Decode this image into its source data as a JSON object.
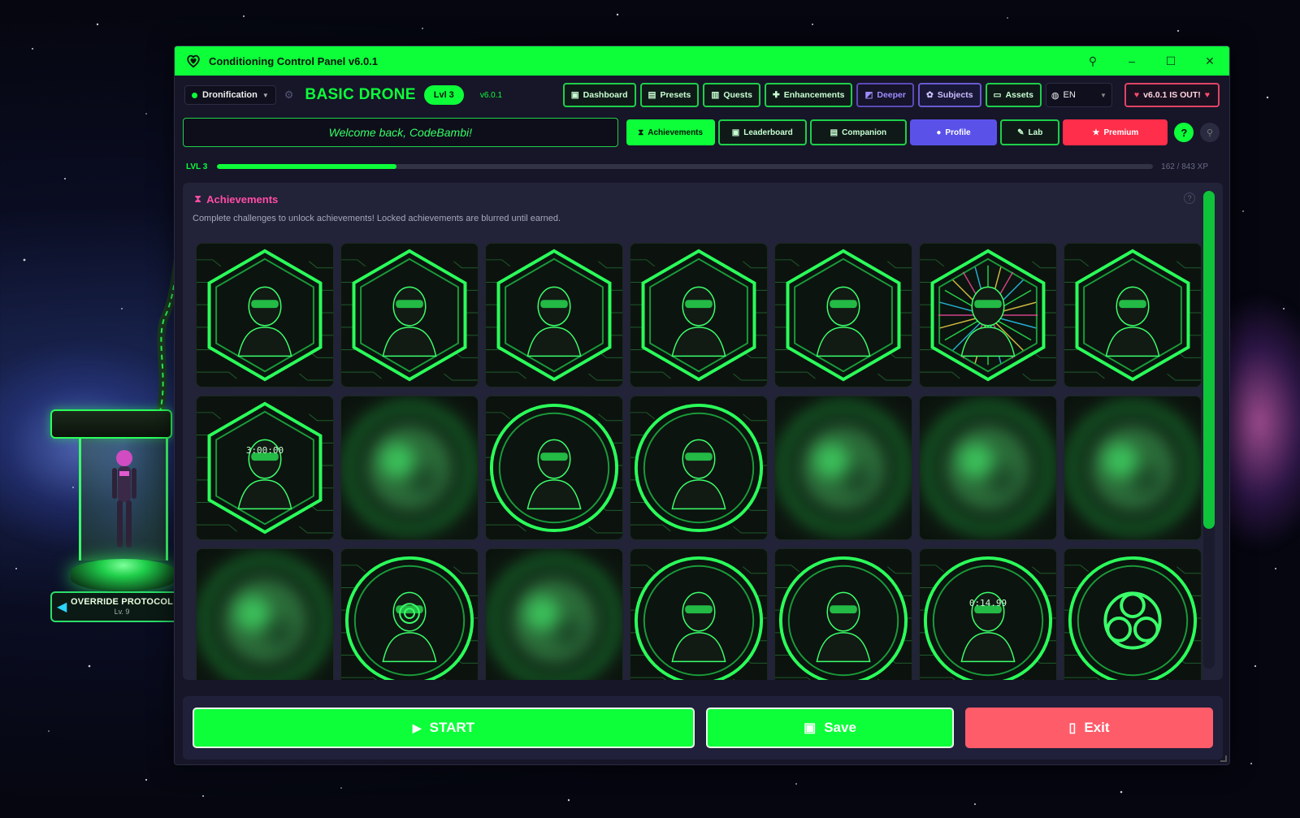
{
  "window": {
    "title": "Conditioning Control Panel v6.0.1"
  },
  "pod": {
    "banner_title": "OVERRIDE PROTOCOL",
    "banner_level": "Lv. 9"
  },
  "header": {
    "mode": "Dronification",
    "rank": "BASIC DRONE",
    "level_pill": "Lvl 3",
    "version": "v6.0.1",
    "nav": [
      "Dashboard",
      "Presets",
      "Quests",
      "Enhancements",
      "Deeper",
      "Subjects",
      "Assets"
    ],
    "language": "EN",
    "update_label": "v6.0.1 IS OUT!"
  },
  "tabs": {
    "welcome": "Welcome back, CodeBambi!",
    "items": [
      "Achievements",
      "Leaderboard",
      "Companion",
      "Profile",
      "Lab",
      "Premium"
    ],
    "help": "?"
  },
  "xp": {
    "level": "LVL 3",
    "text": "162 / 843 XP",
    "progress": 0.192
  },
  "achievements": {
    "title": "Achievements",
    "description": "Complete challenges to unlock achievements! Locked achievements are blurred until earned.",
    "help": "?",
    "tiles": [
      {
        "icon": "vr-visor-face-icon",
        "locked": false,
        "shape": "hex"
      },
      {
        "icon": "terminal-head-icon",
        "locked": false,
        "shape": "hex"
      },
      {
        "icon": "phone-figure-icon",
        "locked": false,
        "shape": "hex"
      },
      {
        "icon": "coder-at-desk-icon",
        "locked": false,
        "shape": "hex"
      },
      {
        "icon": "winged-drone-icon",
        "locked": false,
        "shape": "hex"
      },
      {
        "icon": "neon-burst-figure-icon",
        "locked": false,
        "shape": "hex"
      },
      {
        "icon": "goggles-icon",
        "locked": false,
        "shape": "hex"
      },
      {
        "icon": "timer-chair-icon",
        "locked": false,
        "shape": "hex",
        "label": "3:00:00"
      },
      {
        "icon": "locked-achievement-icon",
        "locked": true,
        "shape": "circle"
      },
      {
        "icon": "checklist-helmet-icon",
        "locked": false,
        "shape": "circle"
      },
      {
        "icon": "helmet-icon",
        "locked": false,
        "shape": "circle"
      },
      {
        "icon": "locked-achievement-icon",
        "locked": true,
        "shape": "circle"
      },
      {
        "icon": "locked-achievement-icon",
        "locked": true,
        "shape": "circle"
      },
      {
        "icon": "locked-achievement-icon",
        "locked": true,
        "shape": "circle"
      },
      {
        "icon": "locked-achievement-icon",
        "locked": true,
        "shape": "circle"
      },
      {
        "icon": "spiral-face-icon",
        "locked": false,
        "shape": "circle"
      },
      {
        "icon": "locked-achievement-icon",
        "locked": true,
        "shape": "circle"
      },
      {
        "icon": "network-tap-icon",
        "locked": false,
        "shape": "circle"
      },
      {
        "icon": "hands-keyboard-icon",
        "locked": false,
        "shape": "circle"
      },
      {
        "icon": "speed-typing-timer-icon",
        "locked": false,
        "shape": "circle",
        "label": "0:14.99"
      },
      {
        "icon": "biohazard-lock-icon",
        "locked": false,
        "shape": "circle"
      }
    ]
  },
  "footer": {
    "start": "START",
    "save": "Save",
    "exit": "Exit"
  },
  "colors": {
    "accent": "#0dff3a",
    "pink": "#ff4da6",
    "profile": "#5a52e8",
    "premium": "#ff2e4a",
    "exit": "#ff5c6a"
  }
}
